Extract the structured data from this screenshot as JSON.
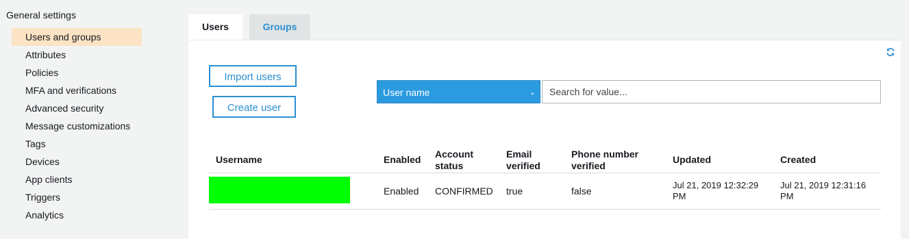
{
  "sidebar": {
    "heading": "General settings",
    "items": [
      {
        "label": "Users and groups"
      },
      {
        "label": "Attributes"
      },
      {
        "label": "Policies"
      },
      {
        "label": "MFA and verifications"
      },
      {
        "label": "Advanced security"
      },
      {
        "label": "Message customizations"
      },
      {
        "label": "Tags"
      },
      {
        "label": "Devices"
      },
      {
        "label": "App clients"
      },
      {
        "label": "Triggers"
      },
      {
        "label": "Analytics"
      }
    ]
  },
  "tabs": [
    {
      "label": "Users"
    },
    {
      "label": "Groups"
    }
  ],
  "toolbar": {
    "import_label": "Import users",
    "create_label": "Create user",
    "filter_selected": "User name",
    "search_placeholder": "Search for value..."
  },
  "table": {
    "headers": {
      "username": "Username",
      "enabled": "Enabled",
      "account_status": [
        "Account",
        "status"
      ],
      "email_verified": [
        "Email",
        "verified"
      ],
      "phone_verified": [
        "Phone number",
        "verified"
      ],
      "updated": "Updated",
      "created": "Created"
    },
    "rows": [
      {
        "enabled": "Enabled",
        "account_status": "CONFIRMED",
        "email_verified": "true",
        "phone_verified": "false",
        "updated": [
          "Jul 21, 2019 12:32:29",
          "PM"
        ],
        "created": [
          "Jul 21, 2019 12:31:16",
          "PM"
        ]
      }
    ]
  },
  "colors": {
    "accent": "#2b8fd1",
    "active_nav": "#fbe3c4",
    "redaction": "#00ff00"
  }
}
